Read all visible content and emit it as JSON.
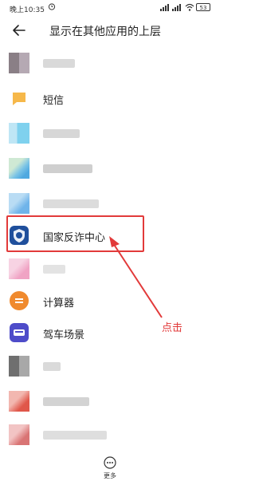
{
  "status_bar": {
    "time": "晚上10:35",
    "battery": "53"
  },
  "header": {
    "title": "显示在其他应用的上层"
  },
  "apps": [
    {
      "label": "",
      "icon": "blurred-app-icon"
    },
    {
      "label": "短信",
      "icon": "messages-icon"
    },
    {
      "label": "",
      "icon": "blurred-app-icon"
    },
    {
      "label": "",
      "icon": "blurred-app-icon"
    },
    {
      "label": "",
      "icon": "blurred-app-icon"
    },
    {
      "label": "国家反诈中心",
      "icon": "shield-icon"
    },
    {
      "label": "",
      "icon": "blurred-app-icon"
    },
    {
      "label": "计算器",
      "icon": "calculator-icon"
    },
    {
      "label": "驾车场景",
      "icon": "car-icon"
    },
    {
      "label": "",
      "icon": "blurred-app-icon"
    },
    {
      "label": "",
      "icon": "blurred-app-icon"
    },
    {
      "label": "",
      "icon": "blurred-app-icon"
    }
  ],
  "annotation": {
    "text": "点击"
  },
  "footer": {
    "more_label": "更多"
  },
  "colors": {
    "highlight": "#e23a3a",
    "calculator": "#f08a2e",
    "car": "#4e4cc9",
    "messages": "#f6b84a"
  }
}
